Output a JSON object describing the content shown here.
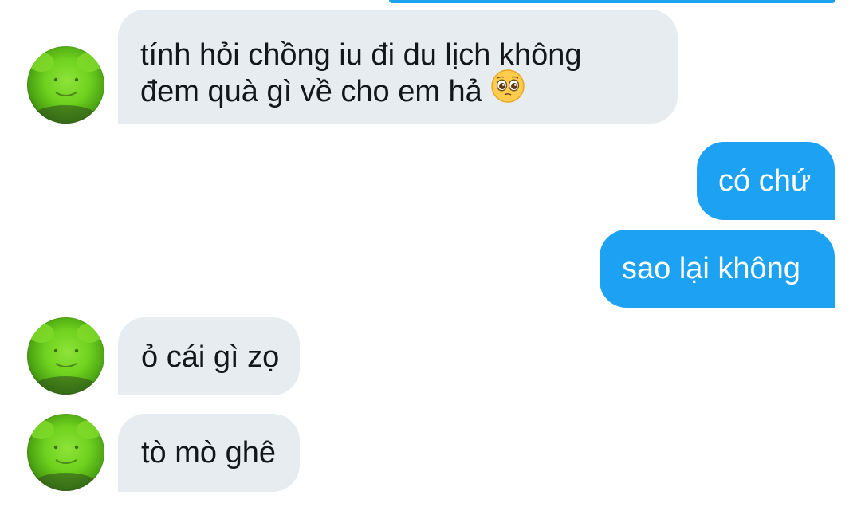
{
  "messages": [
    {
      "direction": "incoming",
      "lines": [
        "tính hỏi chồng iu đi du lịch không",
        "đem quà gì về cho em hả"
      ],
      "emoji": "pleading-face-icon"
    },
    {
      "direction": "outgoing",
      "text": "có chứ"
    },
    {
      "direction": "outgoing",
      "text": "sao lại không"
    },
    {
      "direction": "incoming",
      "text": "ỏ cái gì zọ"
    },
    {
      "direction": "incoming",
      "text": "tò mò ghê"
    }
  ],
  "colors": {
    "outgoing_bubble": "#1da1f2",
    "incoming_bubble": "#e6ecf0",
    "incoming_text": "#14171a",
    "outgoing_text": "#ffffff",
    "avatar_green": "#6fd21e"
  },
  "avatar": {
    "icon": "green-frog-plush-avatar-icon"
  }
}
